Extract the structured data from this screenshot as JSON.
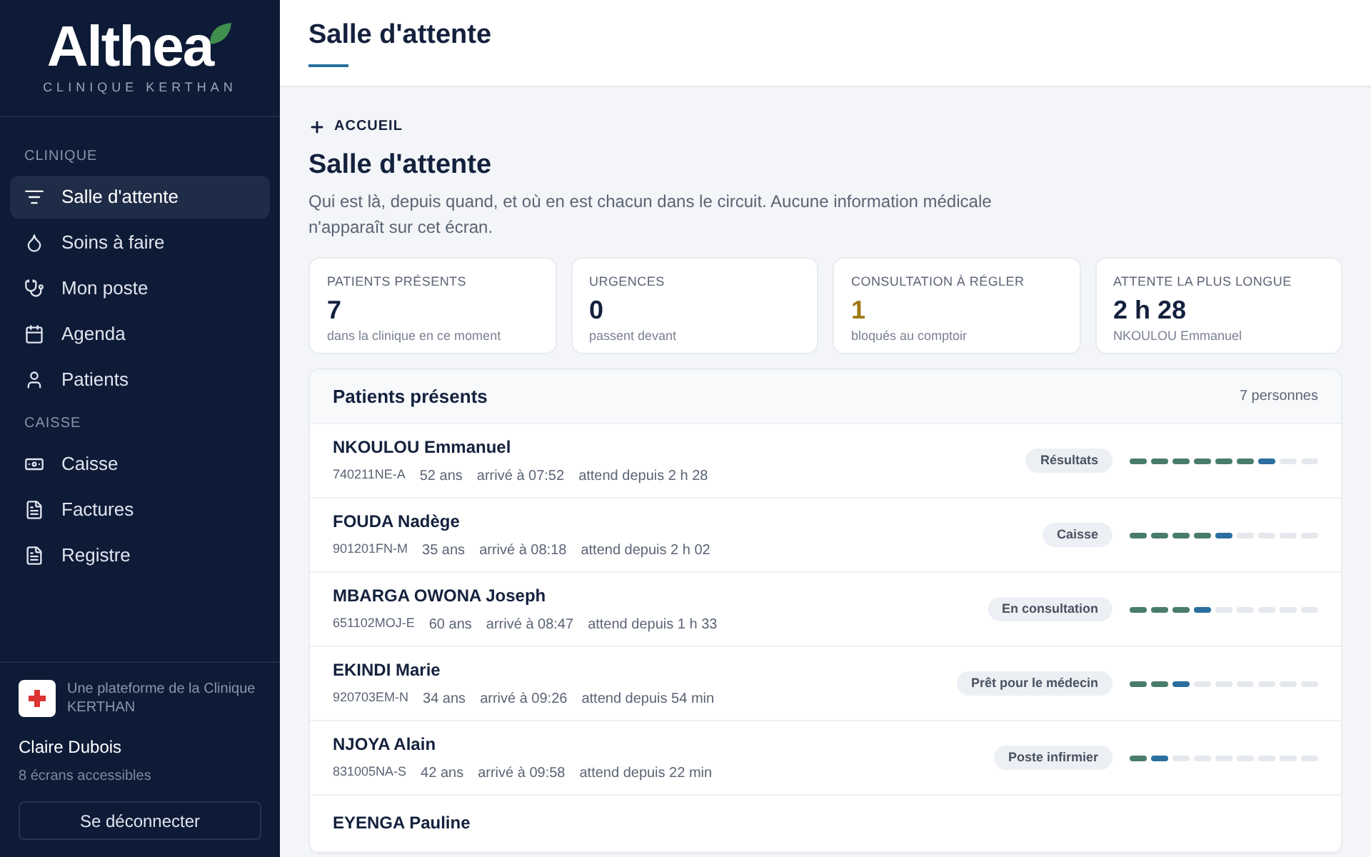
{
  "brand": {
    "name": "Althea",
    "subtitle": "CLINIQUE KERTHAN"
  },
  "sidebar": {
    "sections": [
      {
        "title": "CLINIQUE",
        "items": [
          {
            "label": "Salle d'attente",
            "selected": true
          },
          {
            "label": "Soins à faire",
            "selected": false
          },
          {
            "label": "Mon poste",
            "selected": false
          },
          {
            "label": "Agenda",
            "selected": false
          },
          {
            "label": "Patients",
            "selected": false
          }
        ]
      },
      {
        "title": "CAISSE",
        "items": [
          {
            "label": "Caisse",
            "selected": false
          },
          {
            "label": "Factures",
            "selected": false
          },
          {
            "label": "Registre",
            "selected": false
          }
        ]
      }
    ],
    "platform": "Une plateforme de la Clinique KERTHAN",
    "user": "Claire Dubois",
    "access": "8 écrans accessibles",
    "logout": "Se déconnecter"
  },
  "header": {
    "title": "Salle d'attente"
  },
  "breadcrumb": "ACCUEIL",
  "page": {
    "title": "Salle d'attente",
    "description": "Qui est là, depuis quand, et où en est chacun dans le circuit. Aucune information médicale n'apparaît sur cet écran."
  },
  "stats": [
    {
      "label": "PATIENTS PRÉSENTS",
      "value": "7",
      "note": "dans la clinique en ce moment",
      "highlight": false
    },
    {
      "label": "URGENCES",
      "value": "0",
      "note": "passent devant",
      "highlight": false
    },
    {
      "label": "CONSULTATION À RÉGLER",
      "value": "1",
      "note": "bloqués au comptoir",
      "highlight": true
    },
    {
      "label": "ATTENTE LA PLUS LONGUE",
      "value": "2 h 28",
      "note": "NKOULOU Emmanuel",
      "highlight": false
    }
  ],
  "patients": {
    "title": "Patients présents",
    "count": "7 personnes",
    "rows": [
      {
        "name": "NKOULOU Emmanuel",
        "id": "740211NE-A",
        "age": "52 ans",
        "arrived": "arrivé à 07:52",
        "waiting": "attend depuis 2 h 28",
        "stage": "Résultats",
        "level": 0.778
      },
      {
        "name": "FOUDA Nadège",
        "id": "901201FN-M",
        "age": "35 ans",
        "arrived": "arrivé à 08:18",
        "waiting": "attend depuis 2 h 02",
        "stage": "Caisse",
        "level": 0.556
      },
      {
        "name": "MBARGA OWONA Joseph",
        "id": "651102MOJ-E",
        "age": "60 ans",
        "arrived": "arrivé à 08:47",
        "waiting": "attend depuis 1 h 33",
        "stage": "En consultation",
        "level": 0.444
      },
      {
        "name": "EKINDI Marie",
        "id": "920703EM-N",
        "age": "34 ans",
        "arrived": "arrivé à 09:26",
        "waiting": "attend depuis 54 min",
        "stage": "Prêt pour le médecin",
        "level": 0.333
      },
      {
        "name": "NJOYA Alain",
        "id": "831005NA-S",
        "age": "42 ans",
        "arrived": "arrivé à 09:58",
        "waiting": "attend depuis 22 min",
        "stage": "Poste infirmier",
        "level": 0.222
      },
      {
        "name": "EYENGA Pauline"
      }
    ]
  }
}
